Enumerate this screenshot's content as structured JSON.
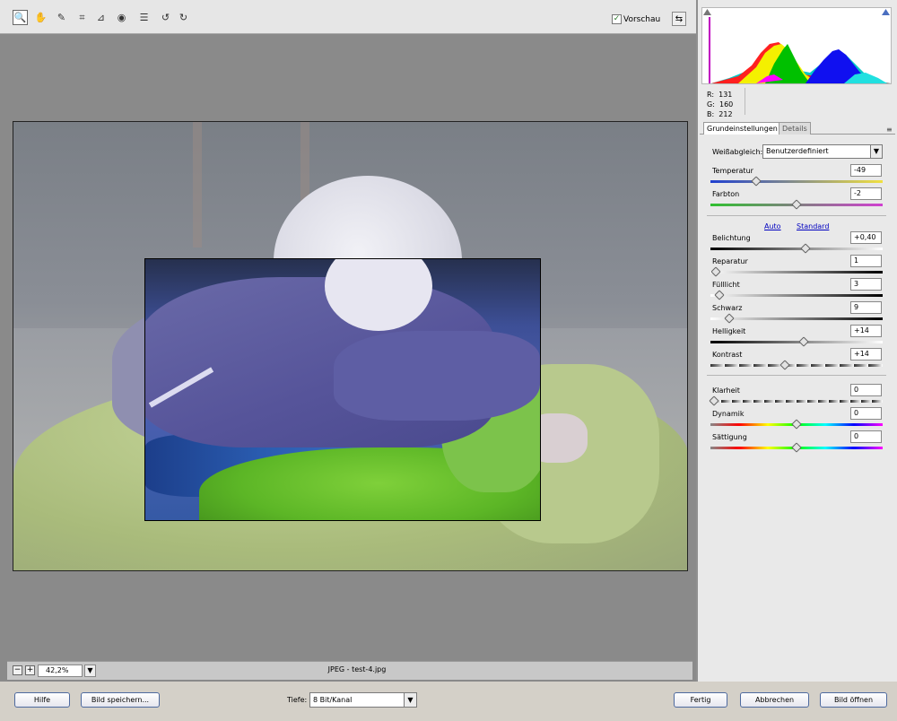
{
  "toolbar": {
    "tools": [
      {
        "icon": "zoom-icon",
        "glyph": "🔍",
        "active": true
      },
      {
        "icon": "hand-icon",
        "glyph": "✋"
      },
      {
        "icon": "white-balance-eyedropper-icon",
        "glyph": "✎"
      },
      {
        "icon": "crop-icon",
        "glyph": "⌗"
      },
      {
        "icon": "straighten-icon",
        "glyph": "⊿"
      },
      {
        "icon": "red-eye-icon",
        "glyph": "◉"
      },
      {
        "icon": "preferences-icon",
        "glyph": "☰"
      },
      {
        "icon": "rotate-left-icon",
        "glyph": "↺"
      },
      {
        "icon": "rotate-right-icon",
        "glyph": "↻"
      }
    ],
    "preview_label": "Vorschau",
    "preview_checked": true
  },
  "canvas": {
    "zoom": "42,2%",
    "filename": "JPEG - test-4.jpg"
  },
  "histogram": {
    "r_label": "R:",
    "r": "131",
    "g_label": "G:",
    "g": "160",
    "b_label": "B:",
    "b": "212"
  },
  "tabs": [
    {
      "label": "Grundeinstellungen",
      "active": true
    },
    {
      "label": "Details",
      "active": false
    }
  ],
  "basic": {
    "wb_label": "Weißabgleich:",
    "wb_value": "Benutzerdefiniert",
    "temperature_label": "Temperatur",
    "temperature": "-49",
    "tint_label": "Farbton",
    "tint": "-2",
    "auto": "Auto",
    "standard": "Standard",
    "exposure_label": "Belichtung",
    "exposure": "+0,40",
    "recovery_label": "Reparatur",
    "recovery": "1",
    "fill_label": "Fülllicht",
    "fill": "3",
    "blacks_label": "Schwarz",
    "blacks": "9",
    "brightness_label": "Helligkeit",
    "brightness": "+14",
    "contrast_label": "Kontrast",
    "contrast": "+14",
    "clarity_label": "Klarheit",
    "clarity": "0",
    "vibrance_label": "Dynamik",
    "vibrance": "0",
    "saturation_label": "Sättigung",
    "saturation": "0"
  },
  "slider_positions": {
    "temperature": 0.25,
    "tint": 0.49,
    "exposure": 0.54,
    "recovery": 0.01,
    "fill": 0.03,
    "blacks": 0.09,
    "brightness": 0.53,
    "contrast": 0.42,
    "clarity": 0.0,
    "vibrance": 0.49,
    "saturation": 0.49
  },
  "footer": {
    "help": "Hilfe",
    "save": "Bild speichern...",
    "depth_label": "Tiefe:",
    "depth_value": "8 Bit/Kanal",
    "done": "Fertig",
    "cancel": "Abbrechen",
    "open": "Bild öffnen"
  }
}
